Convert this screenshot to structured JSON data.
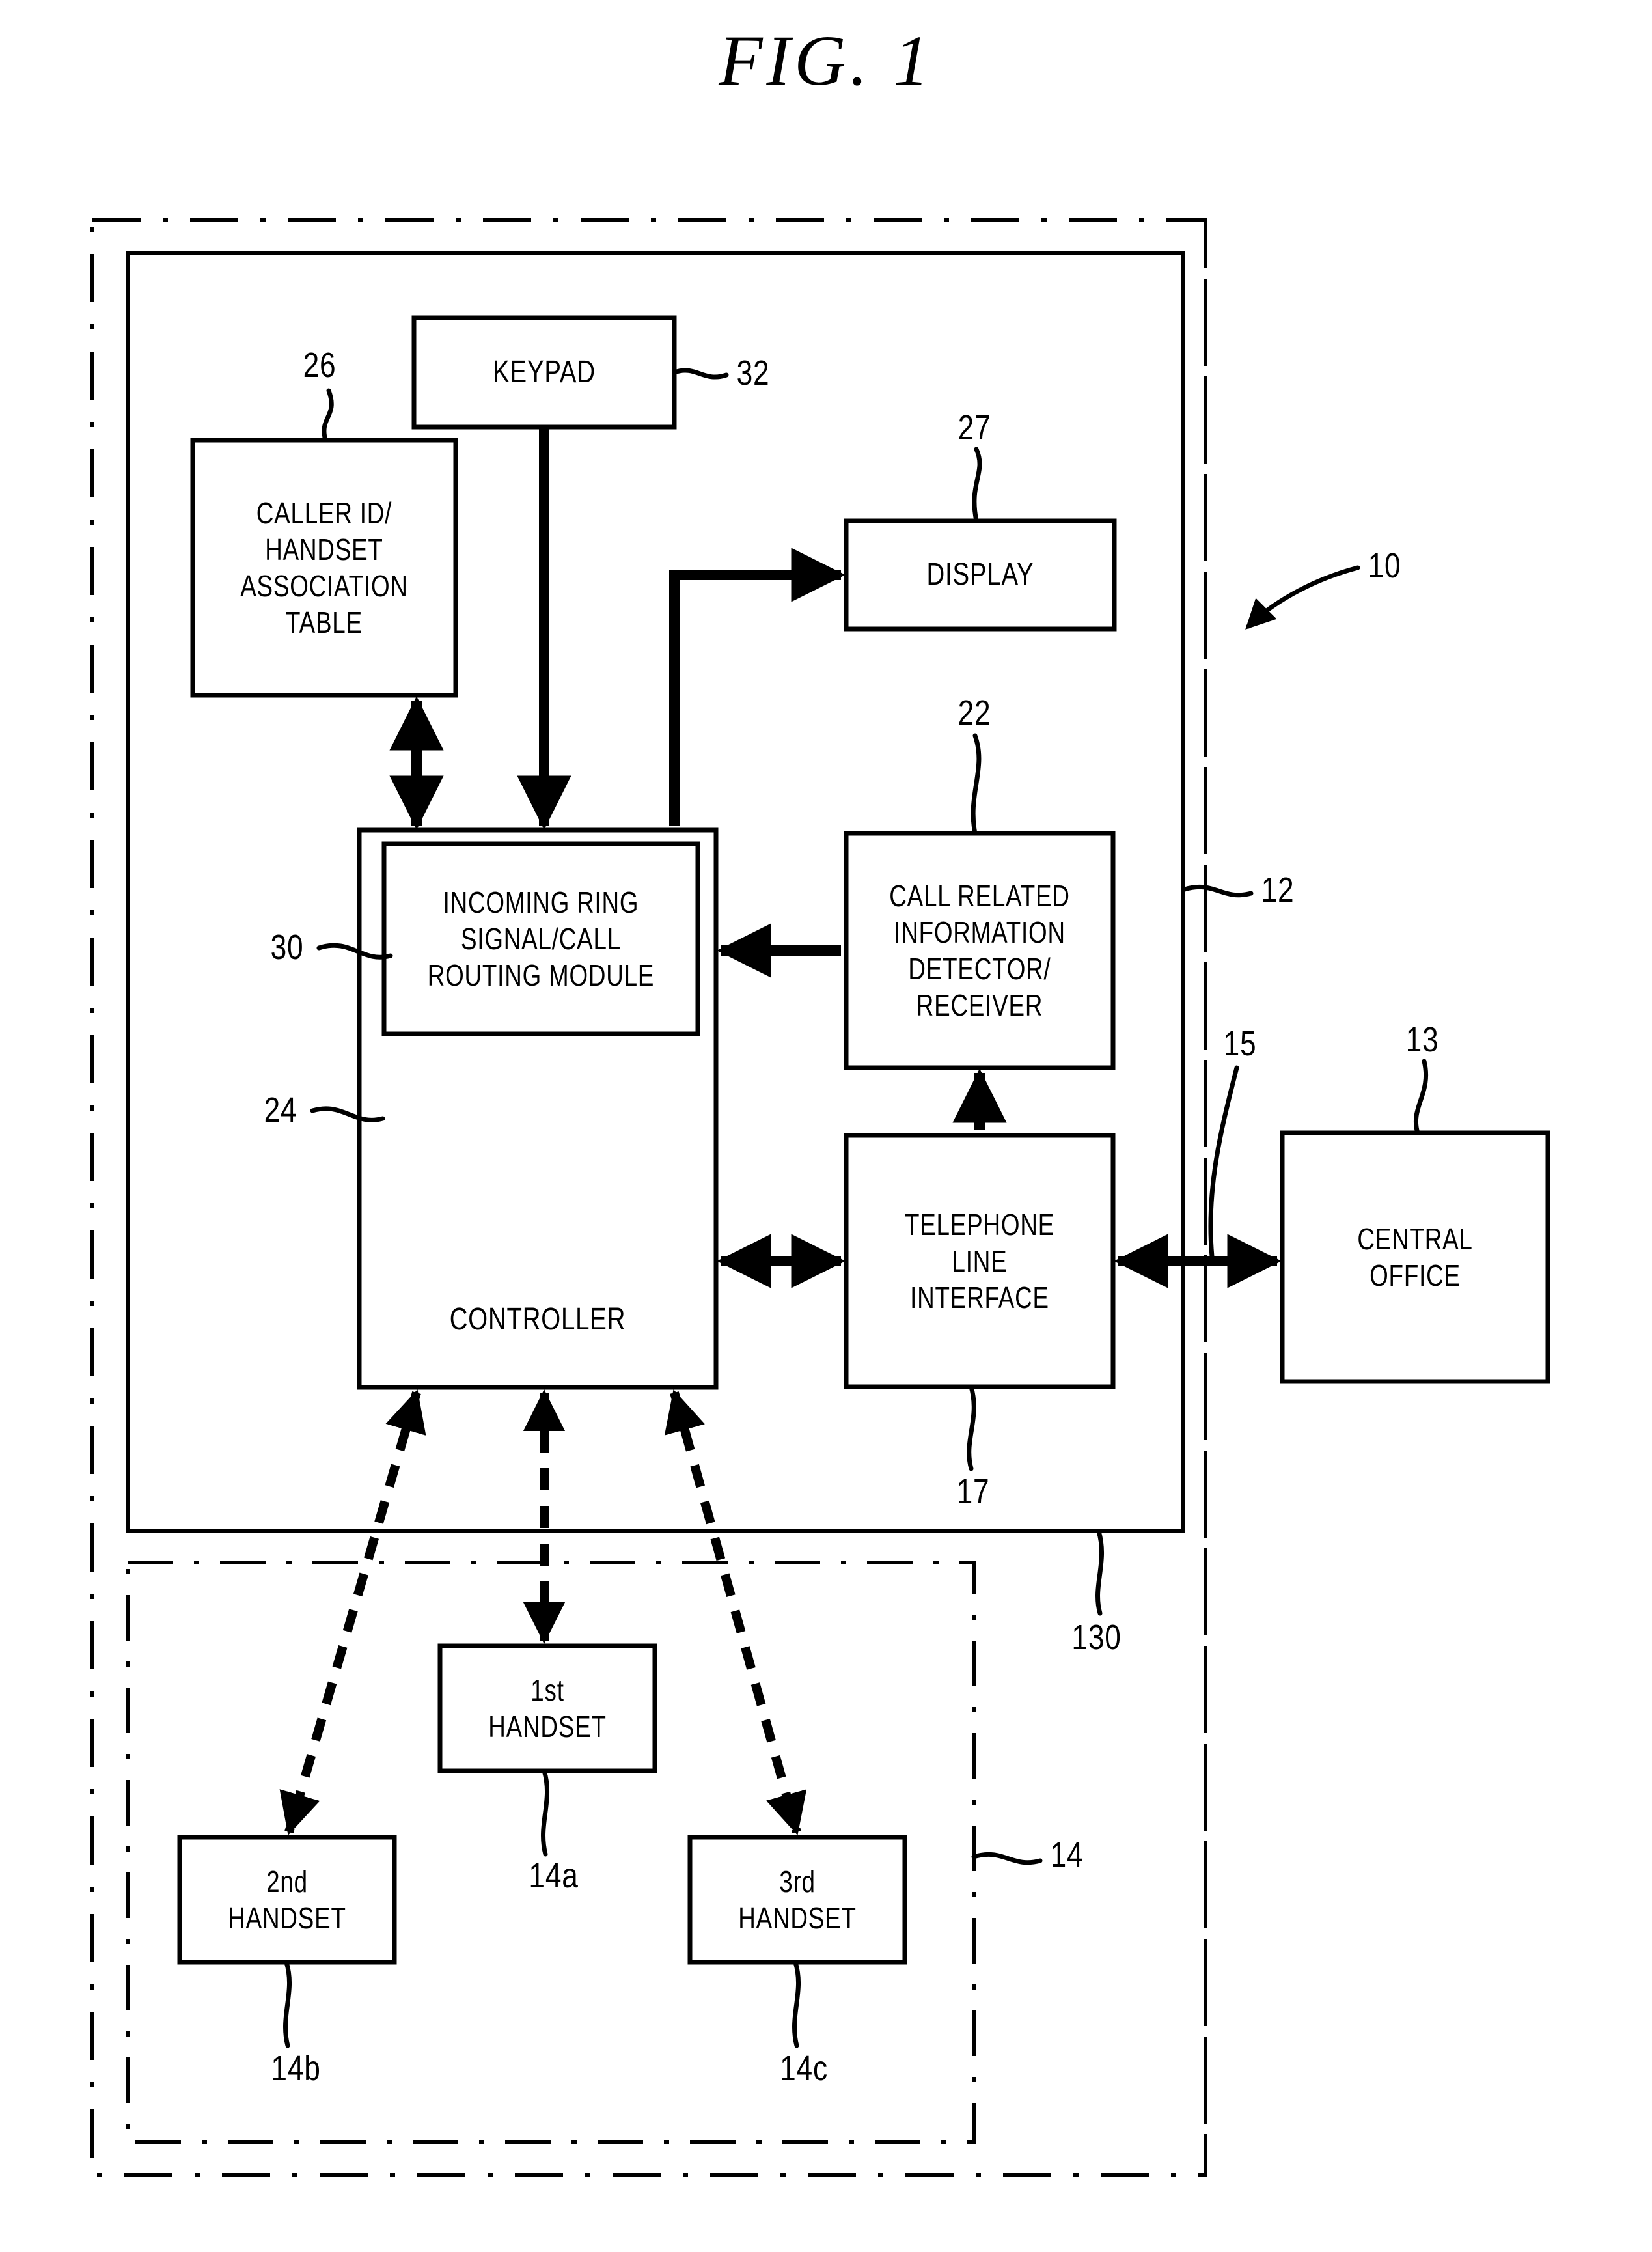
{
  "figure": {
    "title": "FIG.  1",
    "type": "patent-block-diagram"
  },
  "boxes": {
    "keypad": {
      "label": "KEYPAD",
      "ref": "32"
    },
    "caller_id": {
      "label": "CALLER ID/\nHANDSET\nASSOCIATION\nTABLE",
      "ref": "26"
    },
    "display": {
      "label": "DISPLAY",
      "ref": "27"
    },
    "routing_module": {
      "label": "INCOMING RING\nSIGNAL/CALL\nROUTING MODULE",
      "ref": "30"
    },
    "controller": {
      "label": "CONTROLLER",
      "ref": "24"
    },
    "cri_detector": {
      "label": "CALL RELATED\nINFORMATION\nDETECTOR/\nRECEIVER",
      "ref": "22"
    },
    "line_interface": {
      "label": "TELEPHONE\nLINE\nINTERFACE",
      "ref": "17"
    },
    "central_office": {
      "label": "CENTRAL\nOFFICE",
      "ref": "13"
    },
    "handset_1": {
      "label": "1st\nHANDSET",
      "ref": "14a"
    },
    "handset_2": {
      "label": "2nd\nHANDSET",
      "ref": "14b"
    },
    "handset_3": {
      "label": "3rd\nHANDSET",
      "ref": "14c"
    }
  },
  "regions": {
    "system": {
      "ref": "10"
    },
    "base_unit": {
      "ref": "12"
    },
    "base_inner": {
      "ref": "130"
    },
    "handset_group": {
      "ref": "14"
    },
    "telephone_line": {
      "ref": "15"
    }
  },
  "colors": {
    "ink": "#000000",
    "paper": "#ffffff"
  }
}
